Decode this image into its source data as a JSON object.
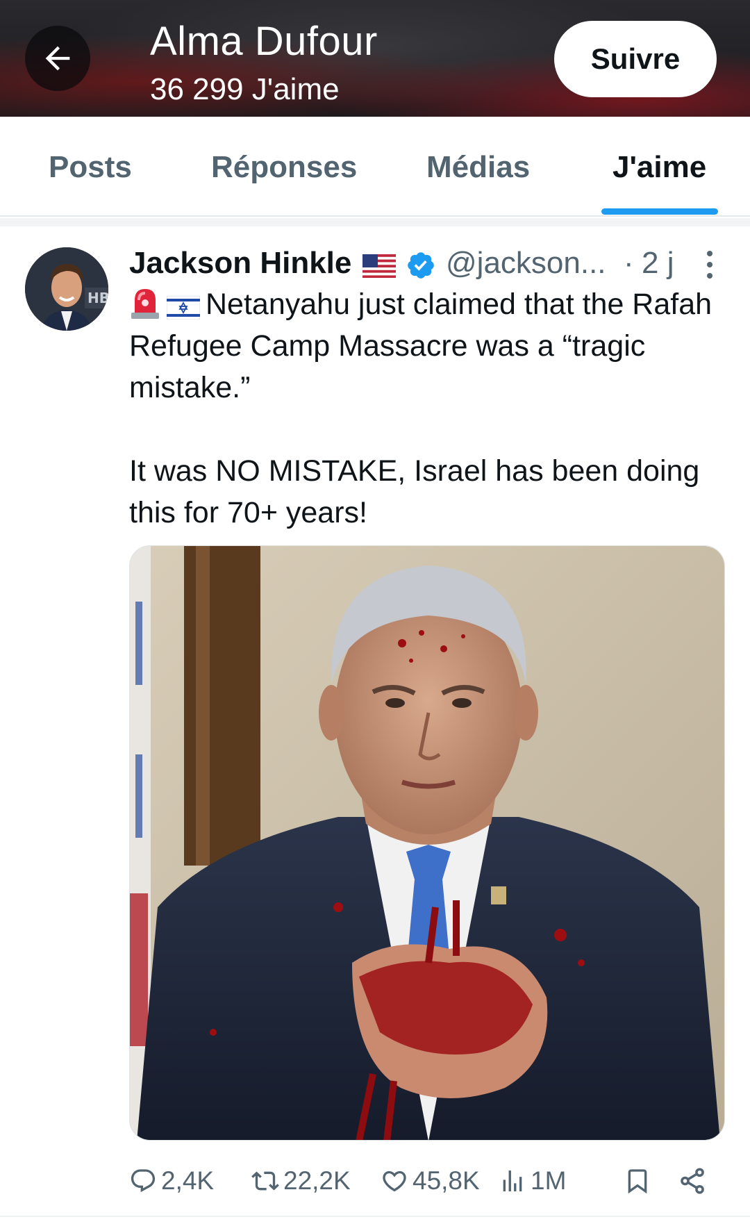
{
  "header": {
    "title": "Alma Dufour",
    "subtitle": "36 299 J'aime",
    "follow_label": "Suivre",
    "back_icon": "arrow-left-icon"
  },
  "tabs": [
    {
      "label": "Posts",
      "active": false
    },
    {
      "label": "Réponses",
      "active": false
    },
    {
      "label": "Médias",
      "active": false
    },
    {
      "label": "J'aime",
      "active": true
    }
  ],
  "post": {
    "author_name": "Jackson Hinkle",
    "author_flag": "us-flag-icon",
    "verified": true,
    "handle": "@jackson...",
    "separator": "·",
    "time": "2 j",
    "lead_emojis": [
      "police-light-icon",
      "israel-flag-icon"
    ],
    "text_line1": "Netanyahu just claimed that the Rafah Refugee Camp Massacre was a “tragic mistake.”",
    "text_line2": "It was NO MISTAKE, Israel has been doing this for 70+ years!",
    "media": "image",
    "stats": {
      "replies": "2,4K",
      "reposts": "22,2K",
      "likes": "45,8K",
      "views": "1M"
    }
  },
  "colors": {
    "accent": "#1d9bf0",
    "text_primary": "#0f1419",
    "text_secondary": "#536471"
  }
}
